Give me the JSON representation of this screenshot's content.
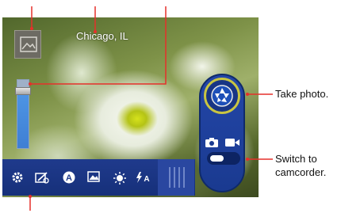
{
  "viewfinder": {
    "location": "Chicago, IL"
  },
  "callouts": {
    "take_photo": "Take photo.",
    "switch_line1": "Switch to",
    "switch_line2": "camcorder."
  },
  "toolbar": {
    "icons": [
      "gear-icon",
      "edit-icon",
      "auto-mode-icon",
      "picture-icon",
      "brightness-icon",
      "flash-auto-icon"
    ]
  },
  "colors": {
    "callout_line": "#e5302b",
    "toolbar": "#1f3a8c",
    "shutter_ring": "#c9c542"
  }
}
